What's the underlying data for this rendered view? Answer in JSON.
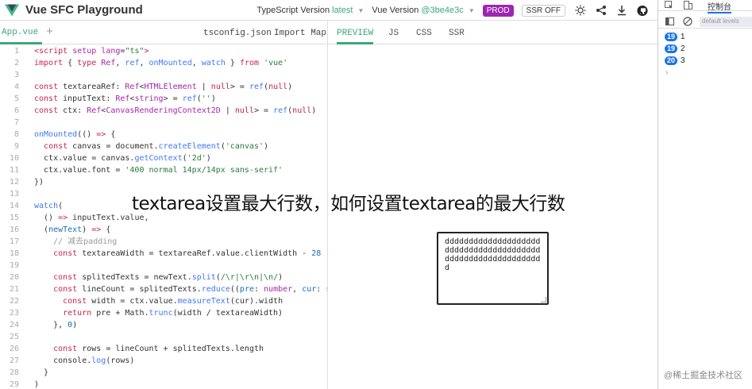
{
  "header": {
    "title": "Vue SFC Playground",
    "ts_label": "TypeScript Version",
    "ts_version": "latest",
    "vue_label": "Vue Version",
    "vue_version": "@3be4e3c",
    "prod_label": "PROD",
    "ssr_label": "SSR OFF",
    "icons": [
      "sun-icon",
      "share-icon",
      "download-icon",
      "github-icon"
    ]
  },
  "editor": {
    "active_tab": "App.vue",
    "add_tab": "+",
    "tabs": [
      "tsconfig.json",
      "Import Map"
    ]
  },
  "preview": {
    "tabs": [
      "PREVIEW",
      "JS",
      "CSS",
      "SSR"
    ],
    "textarea_value": "dddddddddddddddddddd\ndddddddddddddddddddd\ndddddddddddddddddddd\nd"
  },
  "console": {
    "tab_label": "控制台",
    "filter_placeholder": "default levels",
    "logs": [
      {
        "count": "19",
        "value": "1"
      },
      {
        "count": "19",
        "value": "2"
      },
      {
        "count": "20",
        "value": "3"
      }
    ],
    "prompt": "›"
  },
  "overlay": {
    "title": "textarea设置最大行数，如何设置textarea的最大行数",
    "credit": "@稀土掘金技术社区"
  },
  "colors": {
    "accent": "#3ca877",
    "prod": "#9c27b0",
    "badge": "#1a73e8"
  }
}
